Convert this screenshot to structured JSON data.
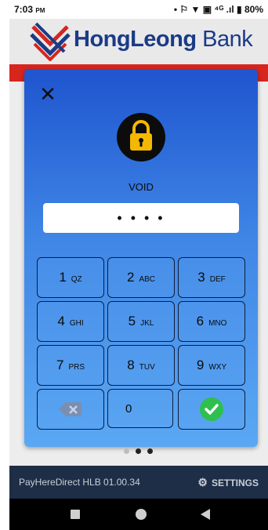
{
  "status_bar": {
    "time": "7:03",
    "ampm": "PM",
    "indicators": "• ⚐ ▼ ▣ ⁴ᴳ .ıl ▮",
    "battery": "80%"
  },
  "header": {
    "brand_bold": "HongLeong",
    "brand_light": " Bank",
    "brand_color": "#1b3b87",
    "accent_red": "#d6261e"
  },
  "modal": {
    "close_icon": "close-icon",
    "lock_icon": "padlock-icon",
    "lock_label": "VOID",
    "pin_mask": "• • • •"
  },
  "keypad": {
    "keys": [
      {
        "num": "1",
        "letters": "QZ"
      },
      {
        "num": "2",
        "letters": "ABC"
      },
      {
        "num": "3",
        "letters": "DEF"
      },
      {
        "num": "4",
        "letters": "GHI"
      },
      {
        "num": "5",
        "letters": "JKL"
      },
      {
        "num": "6",
        "letters": "MNO"
      },
      {
        "num": "7",
        "letters": "PRS"
      },
      {
        "num": "8",
        "letters": "TUV"
      },
      {
        "num": "9",
        "letters": "WXY"
      }
    ],
    "zero": "0",
    "backspace_icon": "backspace-icon",
    "confirm_icon": "check-icon",
    "confirm_color": "#2fbf4e"
  },
  "footer": {
    "version": "PayHereDirect HLB 01.00.34",
    "settings_label": "SETTINGS",
    "settings_icon": "gear-icon"
  },
  "navigation": {
    "recent_icon": "recent-apps-icon",
    "home_icon": "home-icon",
    "back_icon": "back-icon"
  }
}
